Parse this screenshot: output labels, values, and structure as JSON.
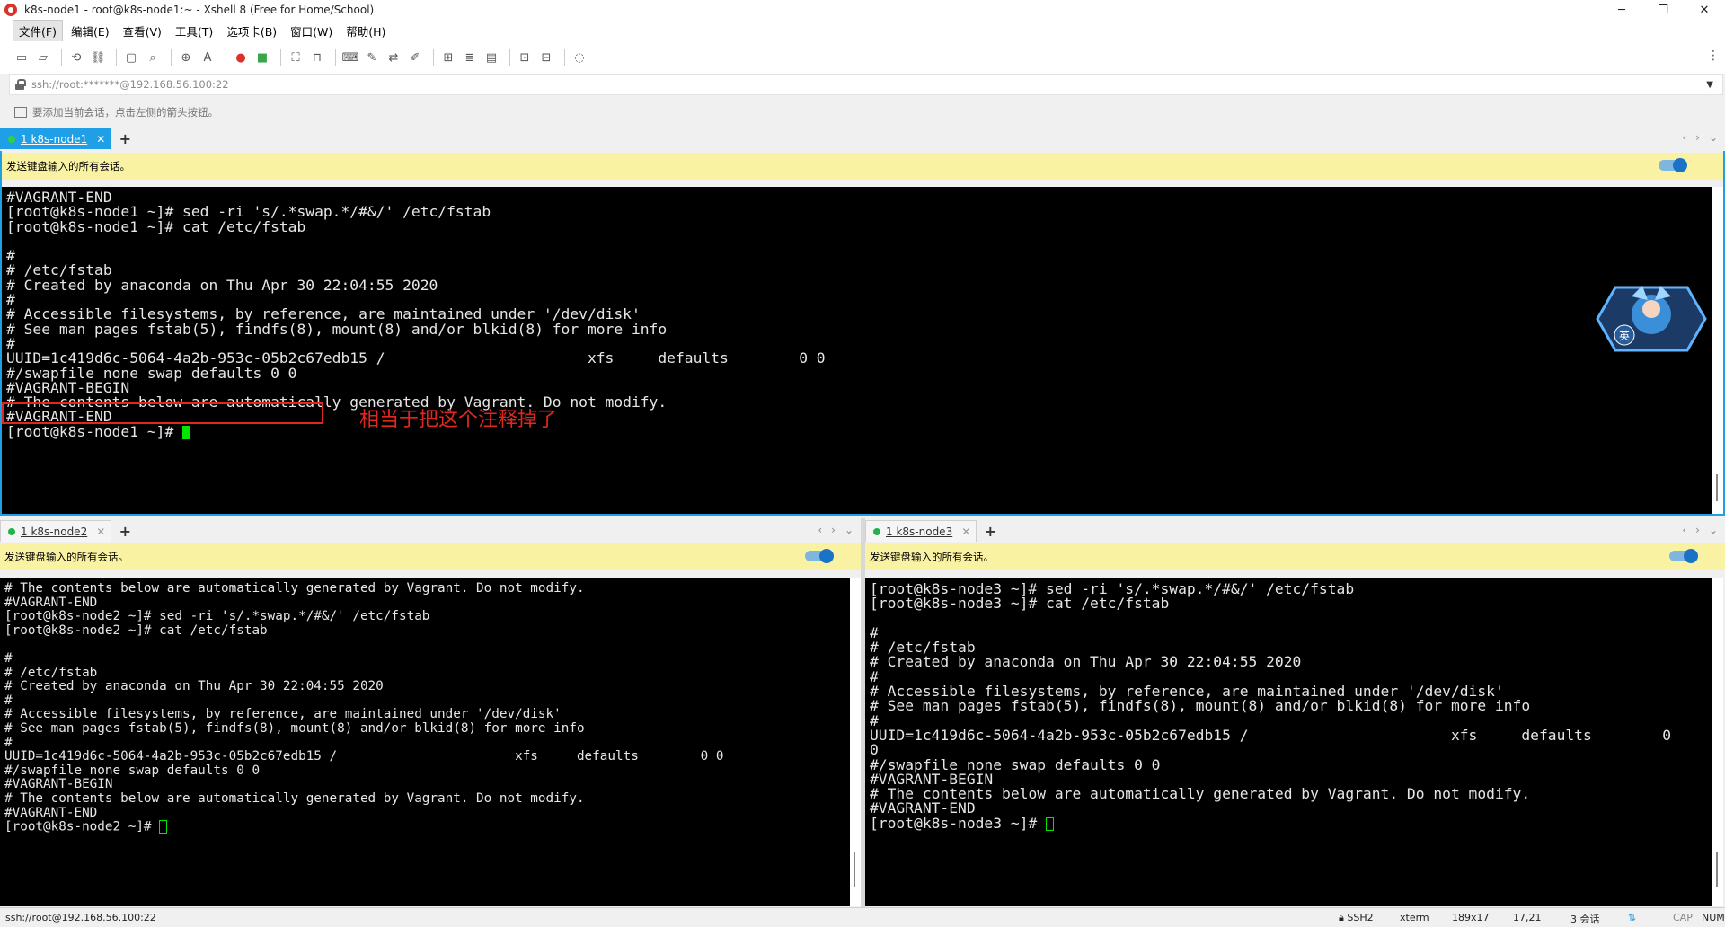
{
  "window": {
    "title": "k8s-node1 - root@k8s-node1:~ - Xshell 8 (Free for Home/School)",
    "controls": {
      "minimize": "─",
      "maximize": "❐",
      "close": "✕"
    }
  },
  "menu": {
    "items": [
      "文件(F)",
      "编辑(E)",
      "查看(V)",
      "工具(T)",
      "选项卡(B)",
      "窗口(W)",
      "帮助(H)"
    ]
  },
  "address": {
    "value": "ssh://root:*******@192.168.56.100:22"
  },
  "hint": {
    "text": "要添加当前会话，点击左侧的箭头按钮。"
  },
  "send_all_text": "发送键盘输入的所有会话。",
  "panes": {
    "node1": {
      "tab_label": "1 k8s-node1",
      "lines": [
        "#VAGRANT-END",
        "[root@k8s-node1 ~]# sed -ri 's/.*swap.*/#&/' /etc/fstab",
        "[root@k8s-node1 ~]# cat /etc/fstab",
        "",
        "#",
        "# /etc/fstab",
        "# Created by anaconda on Thu Apr 30 22:04:55 2020",
        "#",
        "# Accessible filesystems, by reference, are maintained under '/dev/disk'",
        "# See man pages fstab(5), findfs(8), mount(8) and/or blkid(8) for more info",
        "#",
        "UUID=1c419d6c-5064-4a2b-953c-05b2c67edb15 /                       xfs     defaults        0 0",
        "#/swapfile none swap defaults 0 0",
        "#VAGRANT-BEGIN",
        "# The contents below are automatically generated by Vagrant. Do not modify.",
        "#VAGRANT-END"
      ],
      "prompt": "[root@k8s-node1 ~]# ",
      "annotation": "相当于把这个注释掉了",
      "mascot_label": "英"
    },
    "node2": {
      "tab_label": "1 k8s-node2",
      "lines": [
        "# The contents below are automatically generated by Vagrant. Do not modify.",
        "#VAGRANT-END",
        "[root@k8s-node2 ~]# sed -ri 's/.*swap.*/#&/' /etc/fstab",
        "[root@k8s-node2 ~]# cat /etc/fstab",
        "",
        "#",
        "# /etc/fstab",
        "# Created by anaconda on Thu Apr 30 22:04:55 2020",
        "#",
        "# Accessible filesystems, by reference, are maintained under '/dev/disk'",
        "# See man pages fstab(5), findfs(8), mount(8) and/or blkid(8) for more info",
        "#",
        "UUID=1c419d6c-5064-4a2b-953c-05b2c67edb15 /                       xfs     defaults        0 0",
        "#/swapfile none swap defaults 0 0",
        "#VAGRANT-BEGIN",
        "# The contents below are automatically generated by Vagrant. Do not modify.",
        "#VAGRANT-END"
      ],
      "prompt": "[root@k8s-node2 ~]# "
    },
    "node3": {
      "tab_label": "1 k8s-node3",
      "lines": [
        "[root@k8s-node3 ~]# sed -ri 's/.*swap.*/#&/' /etc/fstab",
        "[root@k8s-node3 ~]# cat /etc/fstab",
        "",
        "#",
        "# /etc/fstab",
        "# Created by anaconda on Thu Apr 30 22:04:55 2020",
        "#",
        "# Accessible filesystems, by reference, are maintained under '/dev/disk'",
        "# See man pages fstab(5), findfs(8), mount(8) and/or blkid(8) for more info",
        "#",
        "UUID=1c419d6c-5064-4a2b-953c-05b2c67edb15 /                       xfs     defaults        0",
        "0",
        "#/swapfile none swap defaults 0 0",
        "#VAGRANT-BEGIN",
        "# The contents below are automatically generated by Vagrant. Do not modify.",
        "#VAGRANT-END"
      ],
      "prompt": "[root@k8s-node3 ~]# "
    }
  },
  "status": {
    "address": "ssh://root@192.168.56.100:22",
    "protocol": "SSH2",
    "term": "xterm",
    "size": "189x17",
    "cursor_pos": "17,21",
    "sessions": "3 会话",
    "cap": "CAP",
    "num": "NUM"
  },
  "colors": {
    "active_tab": "#1e9fe6",
    "send_bar": "#faf2a3",
    "annotation": "#e0281f",
    "cursor": "#00e600"
  }
}
